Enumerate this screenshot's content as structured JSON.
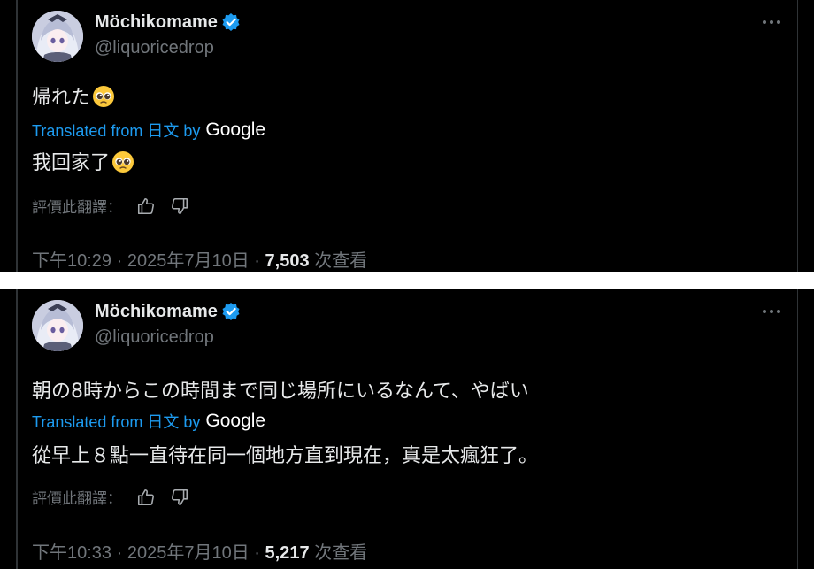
{
  "colors": {
    "background": "#000000",
    "text_primary": "#e7e9ea",
    "text_secondary": "#71767b",
    "accent_link": "#1d9bf0",
    "verified_badge": "#1d9bf0",
    "separator": "#ffffff"
  },
  "icons": {
    "verified": "verified-badge-icon",
    "more": "more-horizontal-icon",
    "thumbs_up": "thumbs-up-icon",
    "thumbs_down": "thumbs-down-icon",
    "emoji": "pleading-face-emoji"
  },
  "posts": [
    {
      "author": {
        "display_name": "Möchikomame",
        "handle": "@liquoricedrop"
      },
      "original_text": "帰れた",
      "translation_label": "Translated from 日文 by",
      "translation_provider": "Google",
      "translated_text": "我回家了",
      "rate_label": "評價此翻譯：",
      "time": "下午10:29",
      "date": "2025年7月10日",
      "sep": "·",
      "views_count": "7,503",
      "views_label": "次查看"
    },
    {
      "author": {
        "display_name": "Möchikomame",
        "handle": "@liquoricedrop"
      },
      "original_text": "朝の8時からこの時間まで同じ場所にいるなんて、やばい",
      "translation_label": "Translated from 日文 by",
      "translation_provider": "Google",
      "translated_text": "從早上８點一直待在同一個地方直到現在，真是太瘋狂了。",
      "rate_label": "評價此翻譯：",
      "time": "下午10:33",
      "date": "2025年7月10日",
      "sep": "·",
      "views_count": "5,217",
      "views_label": "次查看"
    }
  ]
}
